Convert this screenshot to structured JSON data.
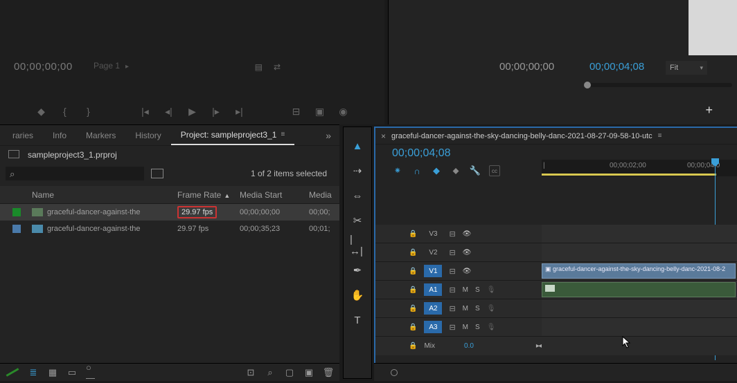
{
  "source_monitor": {
    "timecode": "00;00;00;00",
    "page_label": "Page 1"
  },
  "program_monitor": {
    "timecode_left": "00;00;00;00",
    "timecode_playhead": "00;00;04;08",
    "zoom_label": "Fit"
  },
  "project_panel": {
    "tabs": {
      "libraries": "raries",
      "info": "Info",
      "markers": "Markers",
      "history": "History",
      "project": "Project: sampleproject3_1"
    },
    "bin_name": "sampleproject3_1.prproj",
    "search_placeholder": "⌕",
    "selection_info": "1 of 2 items selected",
    "columns": {
      "name": "Name",
      "frame_rate": "Frame Rate",
      "media_start": "Media Start",
      "media_end": "Media"
    },
    "rows": [
      {
        "name": "graceful-dancer-against-the",
        "frame_rate": "29.97 fps",
        "media_start": "00;00;00;00",
        "media_end": "00;00;"
      },
      {
        "name": "graceful-dancer-against-the",
        "frame_rate": "29.97 fps",
        "media_start": "00;00;35;23",
        "media_end": "00;01;"
      }
    ]
  },
  "timeline": {
    "sequence_name": "graceful-dancer-against-the-sky-dancing-belly-danc-2021-08-27-09-58-10-utc",
    "playhead_tc": "00;00;04;08",
    "ruler_labels": [
      "00;00;02;00",
      "00;00;04;0"
    ],
    "tracks": {
      "v3": "V3",
      "v2": "V2",
      "v1": "V1",
      "a1": "A1",
      "a2": "A2",
      "a3": "A3",
      "m_label": "M",
      "s_label": "S"
    },
    "mix": {
      "label": "Mix",
      "value": "0.0"
    },
    "clip_name": "graceful-dancer-against-the-sky-dancing-belly-danc-2021-08-2"
  }
}
